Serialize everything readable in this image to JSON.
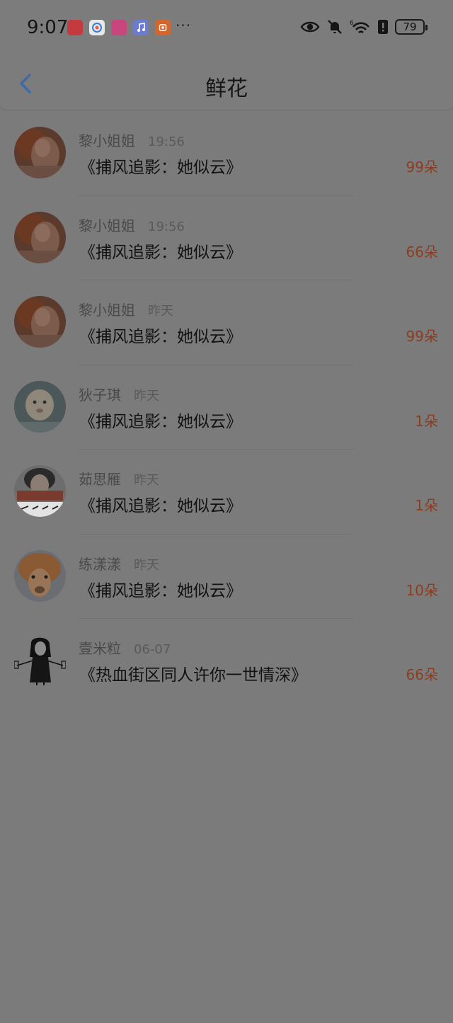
{
  "status_bar": {
    "time": "9:07",
    "battery": "79",
    "apps": [
      {
        "name": "huawei-app-icon",
        "color": "#c43a3e"
      },
      {
        "name": "browser-app-icon",
        "color": "#e8e8e8"
      },
      {
        "name": "lala-app-icon",
        "color": "#c9457e"
      },
      {
        "name": "music-app-icon",
        "color": "#6a7bd1"
      },
      {
        "name": "orange-app-icon",
        "color": "#d4662b"
      }
    ],
    "more": "···",
    "wifi_label": "6"
  },
  "header": {
    "title": "鲜花",
    "accent_color": "#3e6aa8"
  },
  "items": [
    {
      "name": "黎小姐姐",
      "time": "19:56",
      "work": "《捕风追影：她似云》",
      "amount": "99朵"
    },
    {
      "name": "黎小姐姐",
      "time": "19:56",
      "work": "《捕风追影：她似云》",
      "amount": "66朵"
    },
    {
      "name": "黎小姐姐",
      "time": "昨天",
      "work": "《捕风追影：她似云》",
      "amount": "99朵"
    },
    {
      "name": "狄子琪",
      "time": "昨天",
      "work": "《捕风追影：她似云》",
      "amount": "1朵"
    },
    {
      "name": "茹思雁",
      "time": "昨天",
      "work": "《捕风追影：她似云》",
      "amount": "1朵"
    },
    {
      "name": "练漾漾",
      "time": "昨天",
      "work": "《捕风追影：她似云》",
      "amount": "10朵"
    },
    {
      "name": "壹米粒",
      "time": "06-07",
      "work": "《热血街区同人许你一世情深》",
      "amount": "66朵"
    }
  ]
}
